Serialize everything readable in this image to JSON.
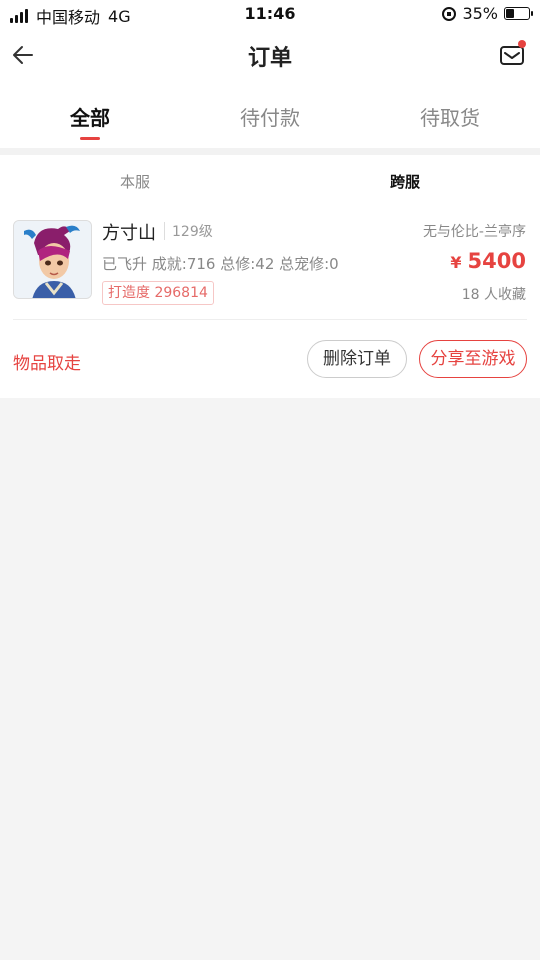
{
  "status_bar": {
    "carrier": "中国移动",
    "network": "4G",
    "time": "11:46",
    "battery": "35%",
    "battery_level": 0.35
  },
  "header": {
    "title": "订单",
    "back_icon": "arrow-left-icon",
    "mail_icon": "envelope-icon",
    "has_unread": true
  },
  "tabs": [
    {
      "label": "全部",
      "active": true
    },
    {
      "label": "待付款",
      "active": false
    },
    {
      "label": "待取货",
      "active": false
    }
  ],
  "server_tabs": [
    {
      "label": "本服",
      "active": false
    },
    {
      "label": "跨服",
      "active": true
    }
  ],
  "order": {
    "character_name": "方寸山",
    "level": "129级",
    "server": "无与伦比-兰亭序",
    "stats": "已飞升 成就:716 总修:42 总宠修:0",
    "price_symbol": "¥",
    "price": "5400",
    "build_score": "打造度 296814",
    "favorites": "18 人收藏",
    "status": "物品取走",
    "delete_label": "删除订单",
    "share_label": "分享至游戏"
  },
  "colors": {
    "accent": "#e64340",
    "text_primary": "#222222",
    "text_secondary": "#888888",
    "background": "#f4f4f4"
  }
}
